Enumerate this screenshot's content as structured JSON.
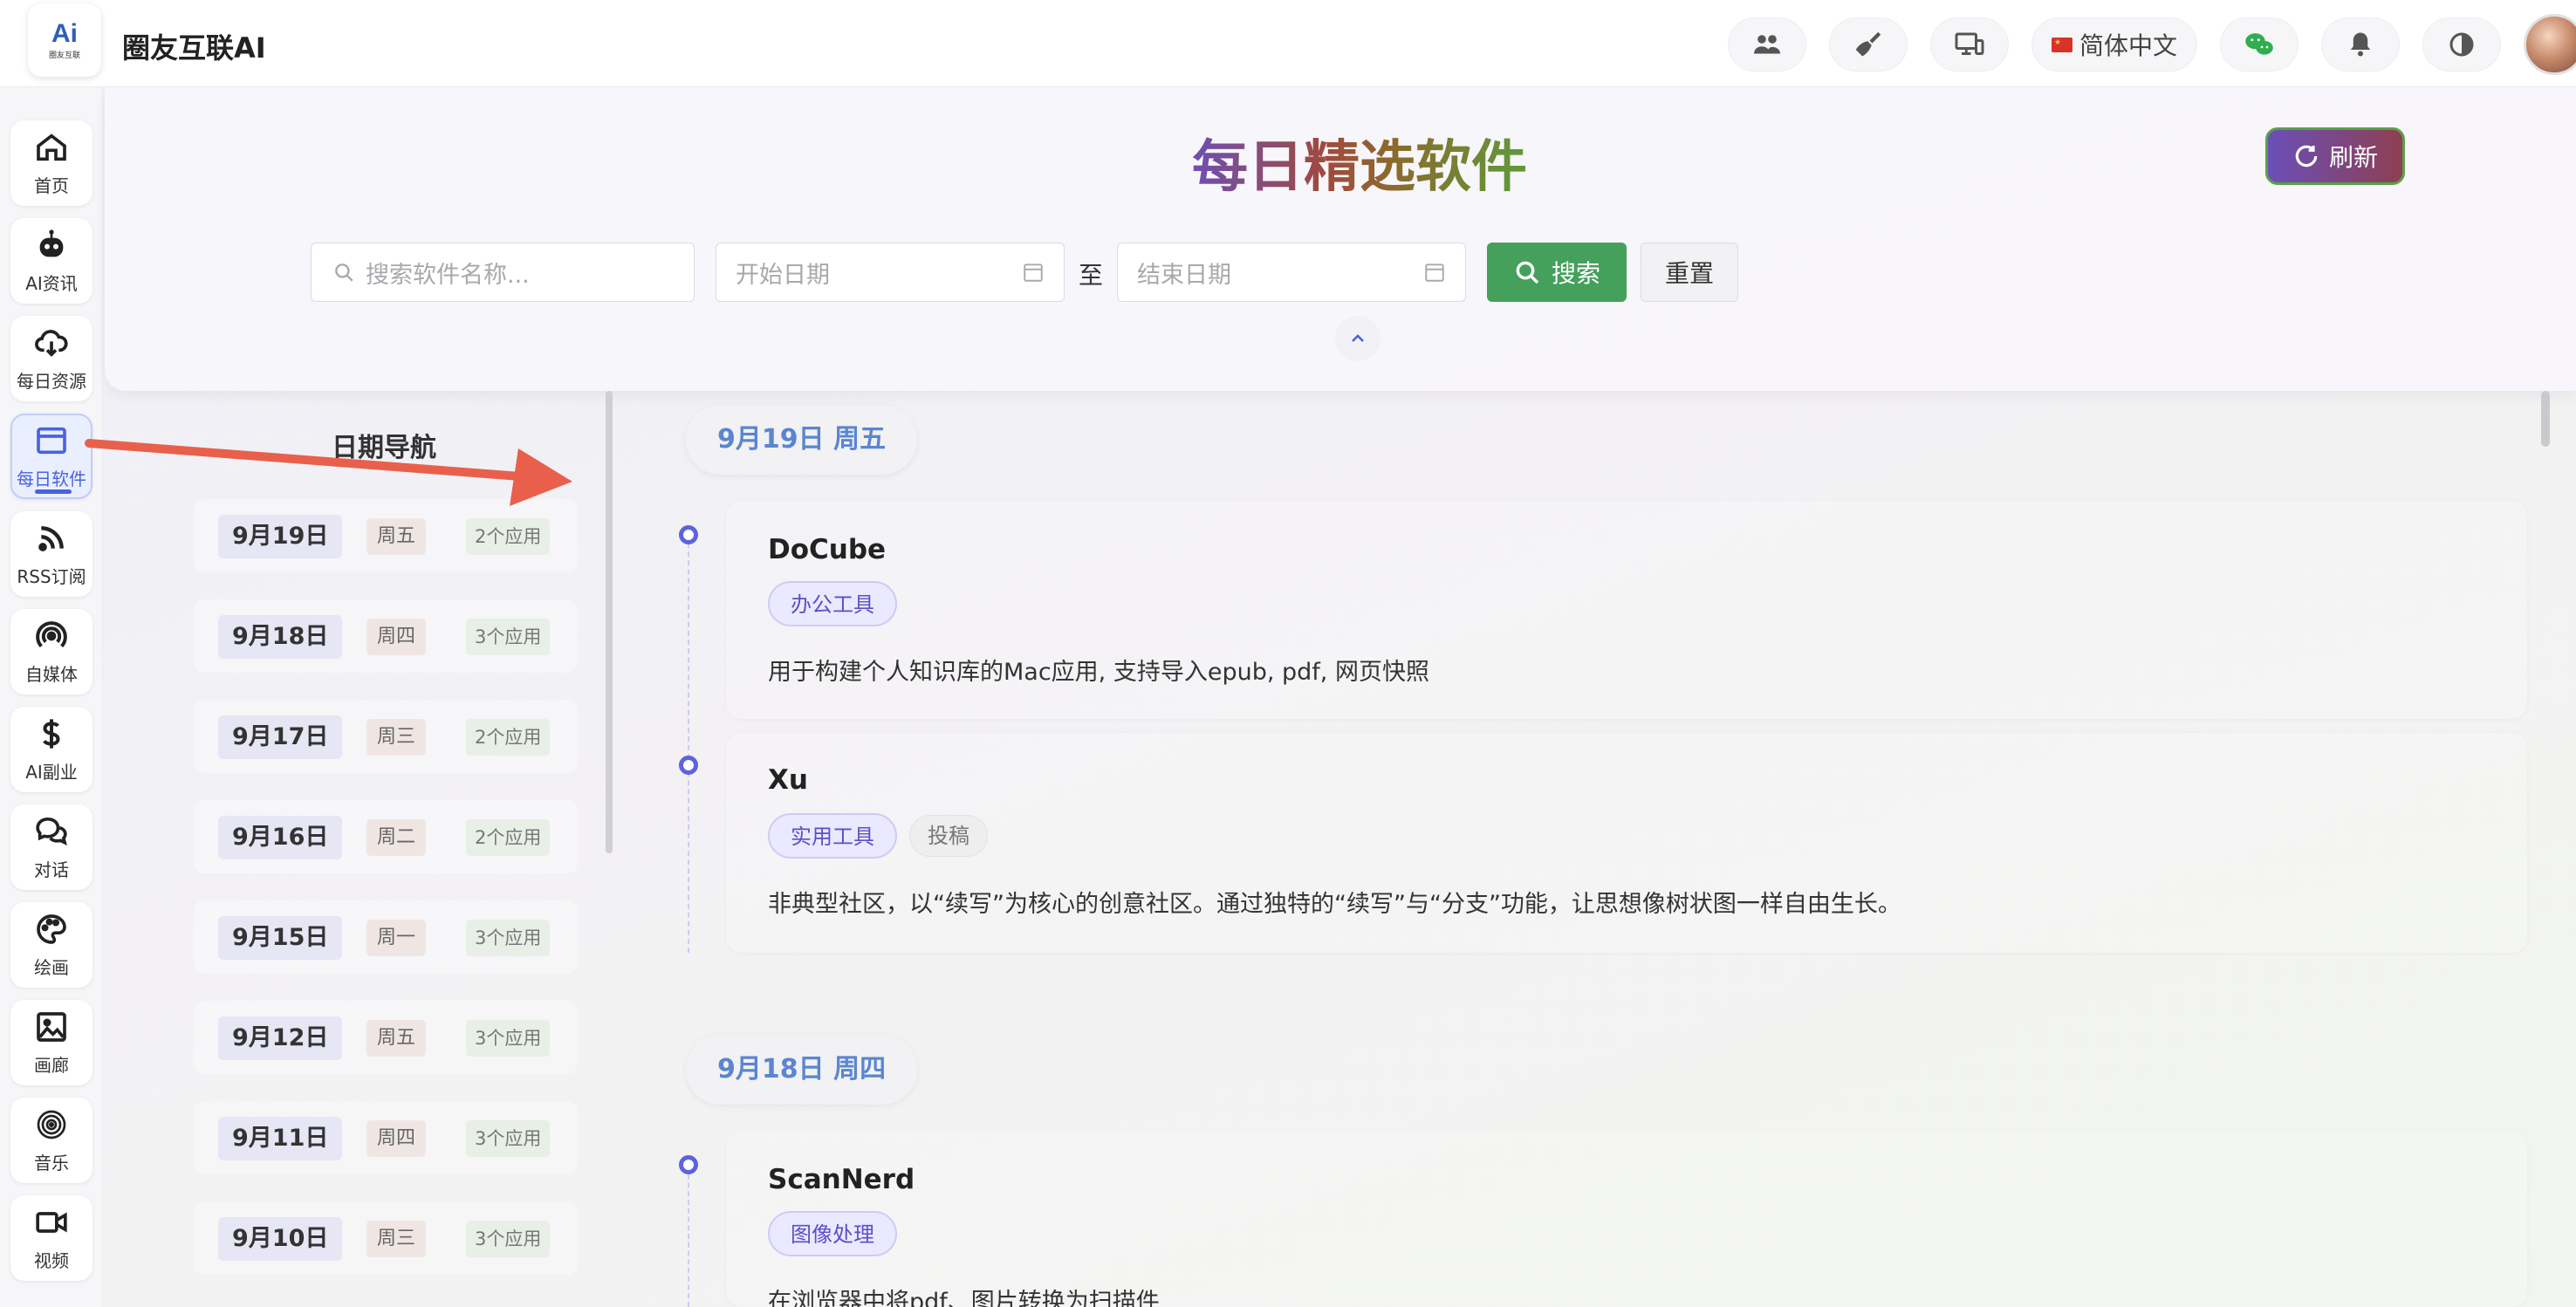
{
  "app": {
    "logo_text": "Ai",
    "logo_sub": "圈友互联",
    "brand": "圈友互联AI"
  },
  "topbar": {
    "language": "简体中文",
    "icons": [
      "users-icon",
      "broom-icon",
      "devices-icon",
      "flag-icon",
      "wechat-icon",
      "bell-icon",
      "contrast-icon"
    ]
  },
  "sidebar": {
    "items": [
      {
        "label": "首页",
        "icon": "home-icon"
      },
      {
        "label": "AI资讯",
        "icon": "robot-icon"
      },
      {
        "label": "每日资源",
        "icon": "cloud-download-icon"
      },
      {
        "label": "每日软件",
        "icon": "window-icon",
        "active": true
      },
      {
        "label": "RSS订阅",
        "icon": "rss-icon"
      },
      {
        "label": "自媒体",
        "icon": "broadcast-icon"
      },
      {
        "label": "AI副业",
        "icon": "dollar-icon"
      },
      {
        "label": "对话",
        "icon": "chat-icon"
      },
      {
        "label": "绘画",
        "icon": "palette-icon"
      },
      {
        "label": "画廊",
        "icon": "image-icon"
      },
      {
        "label": "音乐",
        "icon": "music-icon"
      },
      {
        "label": "视频",
        "icon": "video-icon"
      }
    ]
  },
  "header": {
    "title": "每日精选软件",
    "refresh_label": "刷新",
    "search_placeholder": "搜索软件名称...",
    "start_placeholder": "开始日期",
    "to_label": "至",
    "end_placeholder": "结束日期",
    "search_label": "搜索",
    "reset_label": "重置"
  },
  "date_nav": {
    "title": "日期导航",
    "rows": [
      {
        "date": "9月19日",
        "weekday": "周五",
        "count": "2个应用"
      },
      {
        "date": "9月18日",
        "weekday": "周四",
        "count": "3个应用"
      },
      {
        "date": "9月17日",
        "weekday": "周三",
        "count": "2个应用"
      },
      {
        "date": "9月16日",
        "weekday": "周二",
        "count": "2个应用"
      },
      {
        "date": "9月15日",
        "weekday": "周一",
        "count": "3个应用"
      },
      {
        "date": "9月12日",
        "weekday": "周五",
        "count": "3个应用"
      },
      {
        "date": "9月11日",
        "weekday": "周四",
        "count": "3个应用"
      },
      {
        "date": "9月10日",
        "weekday": "周三",
        "count": "3个应用"
      }
    ]
  },
  "timeline": {
    "days": [
      {
        "header": "9月19日 周五",
        "apps": [
          {
            "name": "DoCube",
            "tags": [
              "办公工具"
            ],
            "desc": "用于构建个人知识库的Mac应用, 支持导入epub, pdf, 网页快照"
          },
          {
            "name": "Xu",
            "tags": [
              "实用工具",
              "投稿"
            ],
            "desc": "非典型社区，以“续写”为核心的创意社区。通过独特的“续写”与“分支”功能，让思想像树状图一样自由生长。"
          }
        ]
      },
      {
        "header": "9月18日 周四",
        "apps": [
          {
            "name": "ScanNerd",
            "tags": [
              "图像处理"
            ],
            "desc": "在浏览器中将pdf、图片转换为扫描件"
          }
        ]
      }
    ]
  },
  "colors": {
    "accent": "#4a62e0",
    "search_green": "#44a05a",
    "timeline_dot": "#5c63dd",
    "arrow": "#e8604c"
  }
}
